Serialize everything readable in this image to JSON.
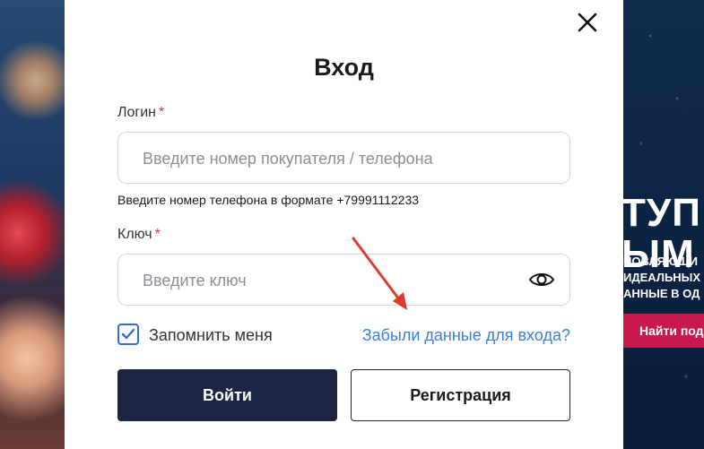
{
  "modal": {
    "title": "Вход",
    "login": {
      "label": "Логин",
      "required_mark": "*",
      "placeholder": "Введите номер покупателя / телефона",
      "hint": "Введите номер телефона в формате +79991112233"
    },
    "password": {
      "label": "Ключ",
      "required_mark": "*",
      "placeholder": "Введите ключ"
    },
    "remember": {
      "label": "Запомнить меня",
      "checked": true
    },
    "forgot_link": "Забыли данные для входа?",
    "login_button": "Войти",
    "register_button": "Регистрация"
  },
  "promo": {
    "title_partial": "ТУП\nЫМ І",
    "subtitle_partial": "НОВЛЯЮЩИ\nИДЕАЛЬНЫХ\nАННЫЕ В ОД",
    "button_partial": "Найти под"
  },
  "colors": {
    "accent_link": "#3b7fdc",
    "primary_button": "#1c2541",
    "required": "#e0304a",
    "promo_button": "#c8194f",
    "annotation_arrow": "#e03a2f"
  },
  "icons": {
    "close": "close-icon",
    "eye": "eye-icon",
    "check": "check-icon"
  }
}
